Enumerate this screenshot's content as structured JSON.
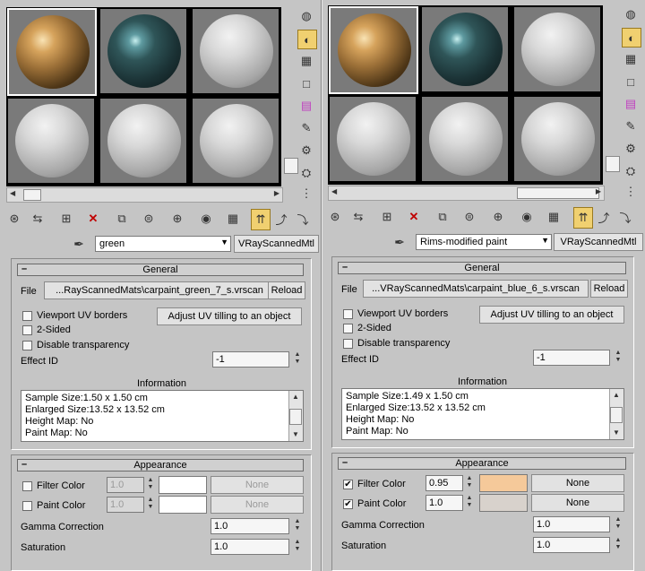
{
  "colors": {
    "panel_bg": "#c5c5c5",
    "selected_tool": "#f0d070",
    "filter_swatch_right": "#f5c99a",
    "paint_swatch_right": "#d8d2cc",
    "swatch_left": "#ffffff"
  },
  "panels": [
    {
      "material_name": "green",
      "material_type": "VRayScannedMtl",
      "general": {
        "header": "General",
        "file_label": "File",
        "file_value": "...RayScannedMats\\carpaint_green_7_s.vrscan",
        "reload": "Reload",
        "viewport_uv": "Viewport UV borders",
        "adjust_uv": "Adjust UV tilling to an object",
        "two_sided": "2-Sided",
        "disable_transparency": "Disable transparency",
        "effect_id_label": "Effect ID",
        "effect_id_value": "-1",
        "information_label": "Information",
        "info_lines": [
          "Sample Size:1.50 x 1.50 cm",
          "Enlarged Size:13.52 x 13.52 cm",
          "Height Map: No",
          "Paint Map: No"
        ]
      },
      "appearance": {
        "header": "Appearance",
        "filter_color_label": "Filter Color",
        "filter_value": "1.0",
        "filter_map": "None",
        "filter_checked": false,
        "paint_color_label": "Paint Color",
        "paint_value": "1.0",
        "paint_map": "None",
        "paint_checked": false,
        "gamma_label": "Gamma Correction",
        "gamma_value": "1.0",
        "saturation_label": "Saturation",
        "saturation_value": "1.0"
      }
    },
    {
      "material_name": "Rims-modified paint",
      "material_type": "VRayScannedMtl",
      "general": {
        "header": "General",
        "file_label": "File",
        "file_value": "...VRayScannedMats\\carpaint_blue_6_s.vrscan",
        "reload": "Reload",
        "viewport_uv": "Viewport UV borders",
        "adjust_uv": "Adjust UV tilling to an object",
        "two_sided": "2-Sided",
        "disable_transparency": "Disable transparency",
        "effect_id_label": "Effect ID",
        "effect_id_value": "-1",
        "information_label": "Information",
        "info_lines": [
          "Sample Size:1.49 x 1.50 cm",
          "Enlarged Size:13.52 x 13.52 cm",
          "Height Map: No",
          "Paint Map: No"
        ]
      },
      "appearance": {
        "header": "Appearance",
        "filter_color_label": "Filter Color",
        "filter_value": "0.95",
        "filter_map": "None",
        "filter_checked": true,
        "paint_color_label": "Paint Color",
        "paint_value": "1.0",
        "paint_map": "None",
        "paint_checked": true,
        "gamma_label": "Gamma Correction",
        "gamma_value": "1.0",
        "saturation_label": "Saturation",
        "saturation_value": "1.0"
      }
    }
  ],
  "check_mark": "✔",
  "icons": {
    "sample_type": "sphere-icon",
    "backlight": "backlight-icon",
    "background": "checker-background-icon",
    "uv_tiling": "uv-tiling-icon",
    "video_check": "video-color-check-icon",
    "make_preview": "make-preview-icon",
    "options": "options-icon",
    "select_by_material": "select-by-material-icon",
    "nav_tree": "material-map-navigator-icon"
  }
}
